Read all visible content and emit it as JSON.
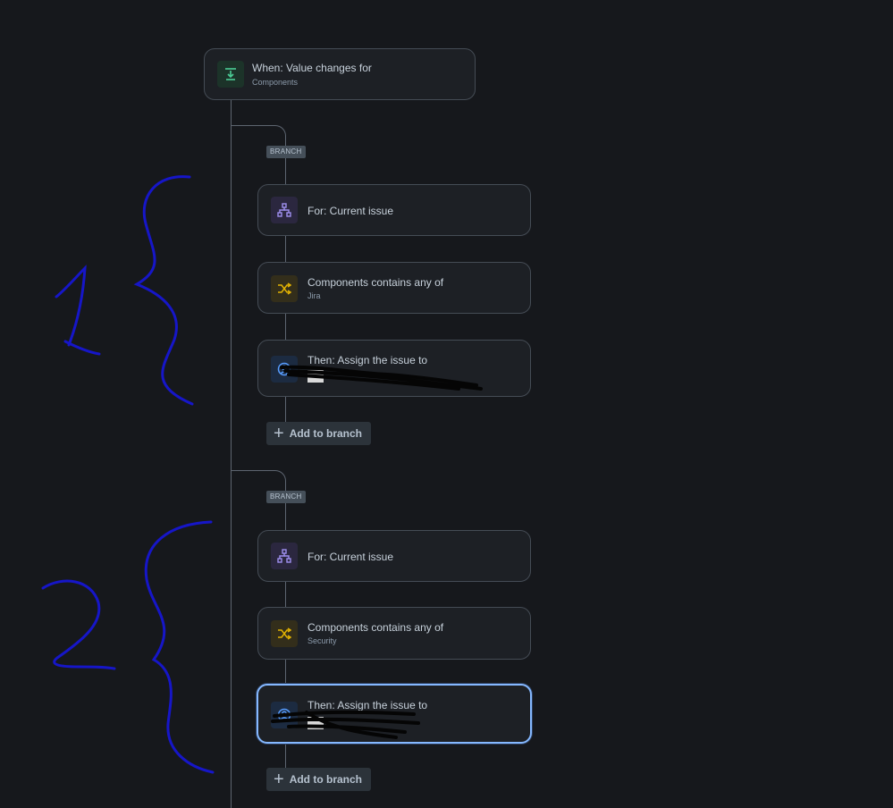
{
  "trigger": {
    "title": "When: Value changes for",
    "subtitle": "Components",
    "icon": "trigger-download-icon"
  },
  "branches": [
    {
      "badge": "BRANCH",
      "for_card": {
        "title": "For: Current issue",
        "icon": "branch-hierarchy-icon"
      },
      "condition_card": {
        "title": "Components contains any of",
        "subtitle": "Jira",
        "icon": "shuffle-condition-icon"
      },
      "action_card": {
        "title": "Then: Assign the issue to",
        "icon": "user-assign-icon"
      },
      "add_button": "Add to branch"
    },
    {
      "badge": "BRANCH",
      "for_card": {
        "title": "For: Current issue",
        "icon": "branch-hierarchy-icon"
      },
      "condition_card": {
        "title": "Components contains any of",
        "subtitle": "Security",
        "icon": "shuffle-condition-icon"
      },
      "action_card": {
        "title": "Then: Assign the issue to",
        "icon": "user-assign-icon"
      },
      "add_button": "Add to branch"
    }
  ],
  "colors": {
    "background": "#16181c",
    "card": "#1d2025",
    "connector": "#5d6570",
    "selected_border": "#85b8ff",
    "annotation_ink": "#1616c8"
  }
}
